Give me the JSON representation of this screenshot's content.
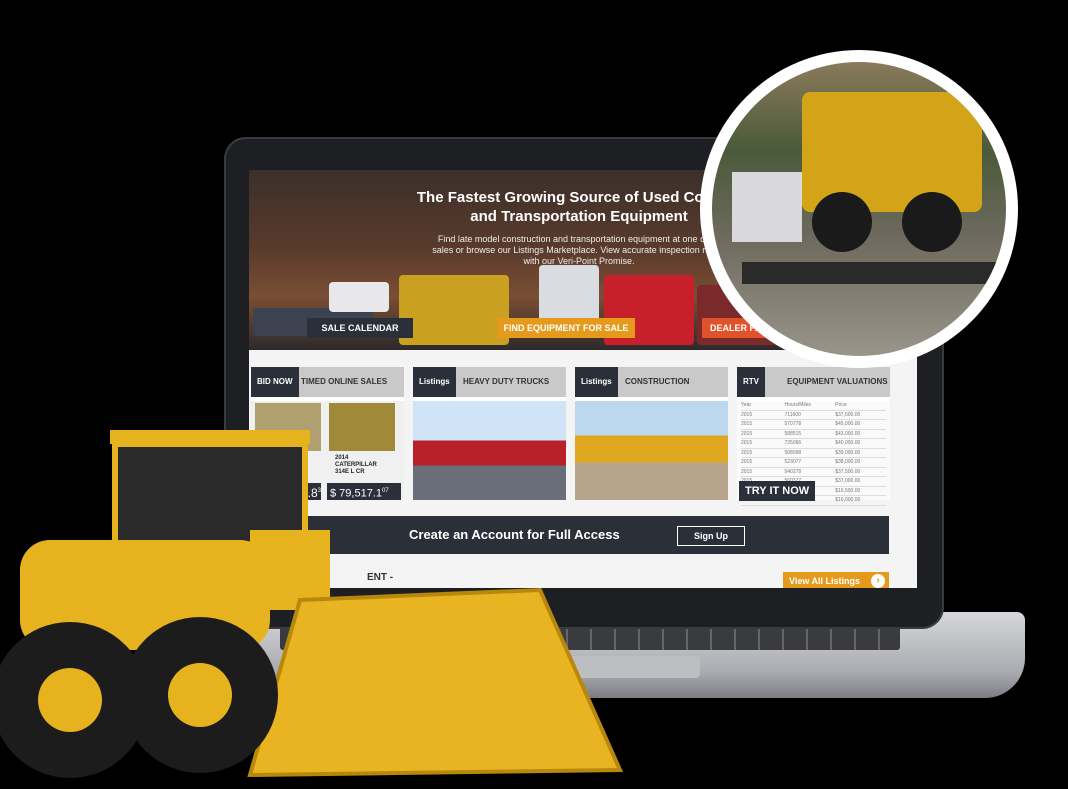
{
  "hero": {
    "title_line1": "The Fastest Growing Source of Used Constru",
    "title_line2": "and Transportation Equipment",
    "subtitle_line1": "Find late model construction and transportation equipment at one of ou",
    "subtitle_line2": "sales or browse our Listings Marketplace. View accurate inspection report",
    "subtitle_line3": "with our Veri-Point Promise.",
    "buttons": {
      "sale_calendar": "SALE CALENDAR",
      "find_equipment": "FIND EQUIPMENT FOR SALE",
      "dealer": "DEALER PART"
    }
  },
  "cards": [
    {
      "tag": "BID NOW",
      "label": "TIMED ONLINE SALES",
      "item_year": "2014",
      "item_make": "CATERPILLAR",
      "item_model": "314E L CR",
      "price_left": "76.8",
      "price_left_suffix": "3",
      "price_right": "$ 79,517.1",
      "price_right_suffix": "07"
    },
    {
      "tag": "Listings",
      "label": "HEAVY DUTY TRUCKS"
    },
    {
      "tag": "Listings",
      "label": "CONSTRUCTION"
    },
    {
      "tag": "RTV",
      "label": "EQUIPMENT VALUATIONS",
      "cta": "TRY IT NOW",
      "table_headers": [
        "Year",
        "Hours/Miles",
        "Price"
      ],
      "table_rows": [
        [
          "2015",
          "711600",
          "$37,500.00"
        ],
        [
          "2015",
          "570778",
          "$45,000.00"
        ],
        [
          "2015",
          "588515",
          "$43,000.00"
        ],
        [
          "2015",
          "725066",
          "$40,000.00"
        ],
        [
          "2015",
          "508998",
          "$39,000.00"
        ],
        [
          "2015",
          "523077",
          "$38,000.00"
        ],
        [
          "2015",
          "540278",
          "$37,500.00"
        ],
        [
          "2015",
          "560377",
          "$37,000.00"
        ],
        [
          "2015",
          "575881",
          "$16,500.00"
        ],
        [
          "2015",
          "",
          "$16,000.00"
        ]
      ]
    }
  ],
  "signup": {
    "text": "Create an Account for Full Access",
    "button": "Sign Up"
  },
  "footer": {
    "partial_text": "ENT -",
    "view_all": "View All Listings"
  },
  "colors": {
    "accent_orange": "#e59a1b",
    "dark_navy": "#2a2f3a",
    "dealer_red": "#e0522a",
    "loader_yellow": "#e6b21e"
  }
}
